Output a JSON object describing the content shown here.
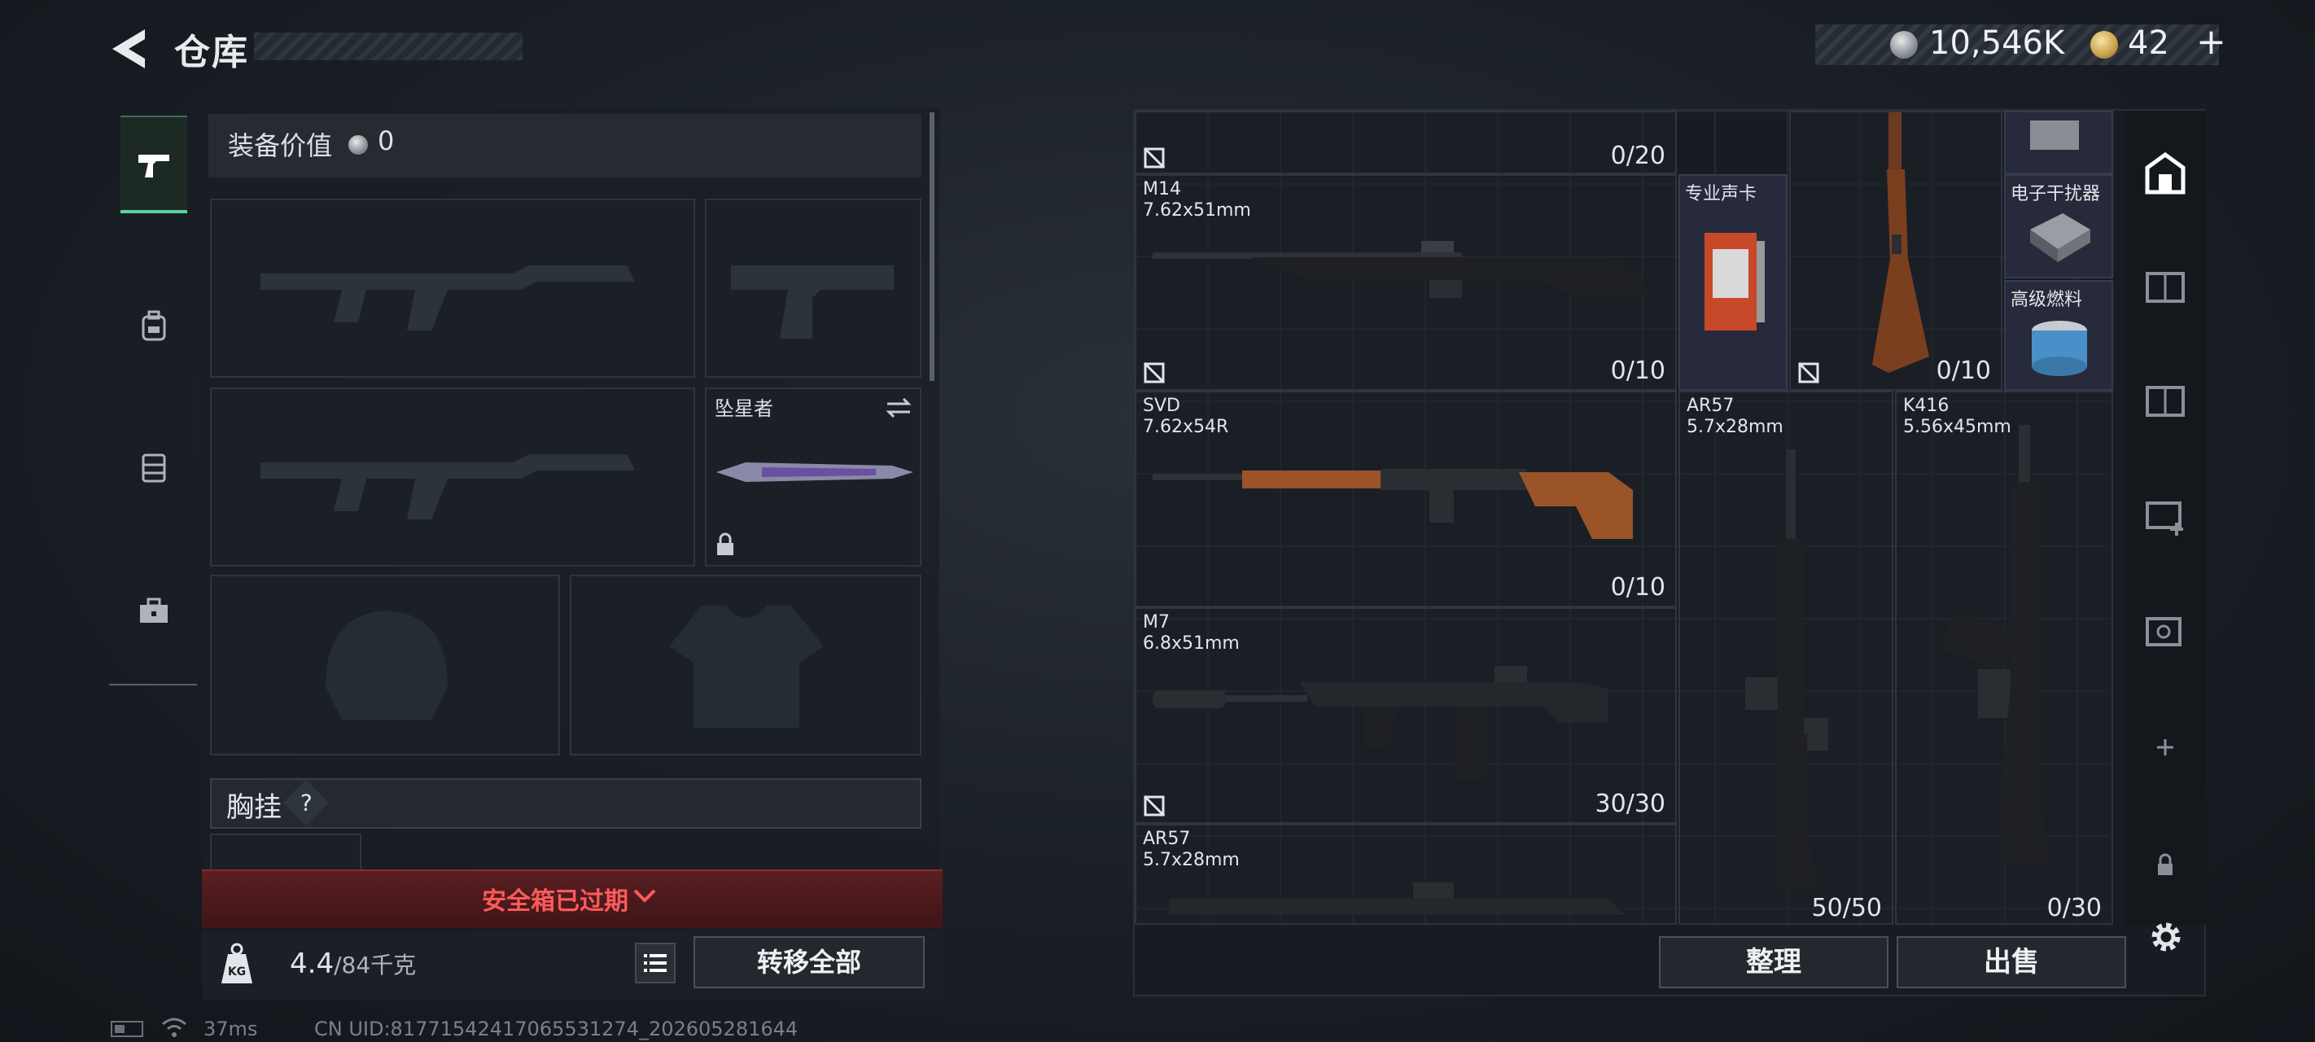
{
  "header": {
    "title": "仓库",
    "money": "10,546K",
    "tickets": "42",
    "plus_label": "+"
  },
  "loadout": {
    "equipment_value_label": "装备价值",
    "equipment_value": "0",
    "melee_name": "坠星者",
    "chest_rig_label": "胸挂",
    "chest_rig_help": "?",
    "safe_box_status": "安全箱已过期",
    "weight_current": "4.4",
    "weight_max": "/84千克",
    "transfer_all_label": "转移全部"
  },
  "storage": {
    "top_left_ammo": "0/20",
    "weapons": [
      {
        "name": "M14",
        "caliber": "7.62x51mm",
        "ammo": "0/10"
      },
      {
        "name": "SVD",
        "caliber": "7.62x54R",
        "ammo": "0/10"
      },
      {
        "name": "M7",
        "caliber": "6.8x51mm",
        "ammo": "30/30"
      },
      {
        "name": "AR57",
        "caliber": "5.7x28mm",
        "ammo": ""
      },
      {
        "name": "AR57",
        "caliber": "5.7x28mm",
        "ammo": "50/50"
      },
      {
        "name": "K416",
        "caliber": "5.56x45mm",
        "ammo": "0/30"
      }
    ],
    "rifle_stock_ammo": "0/10",
    "items": [
      {
        "name": "专业声卡"
      },
      {
        "name": "电子干扰器"
      },
      {
        "name": "高级燃料"
      }
    ],
    "sort_label": "整理",
    "sell_label": "出售"
  },
  "footer": {
    "ping": "37ms",
    "uid": "CN UID:81771542417065531274_202605281644"
  },
  "colors": {
    "accent_green": "#5ad3a0",
    "warning_red": "#ff5a5a",
    "gold": "#c9a04a"
  }
}
